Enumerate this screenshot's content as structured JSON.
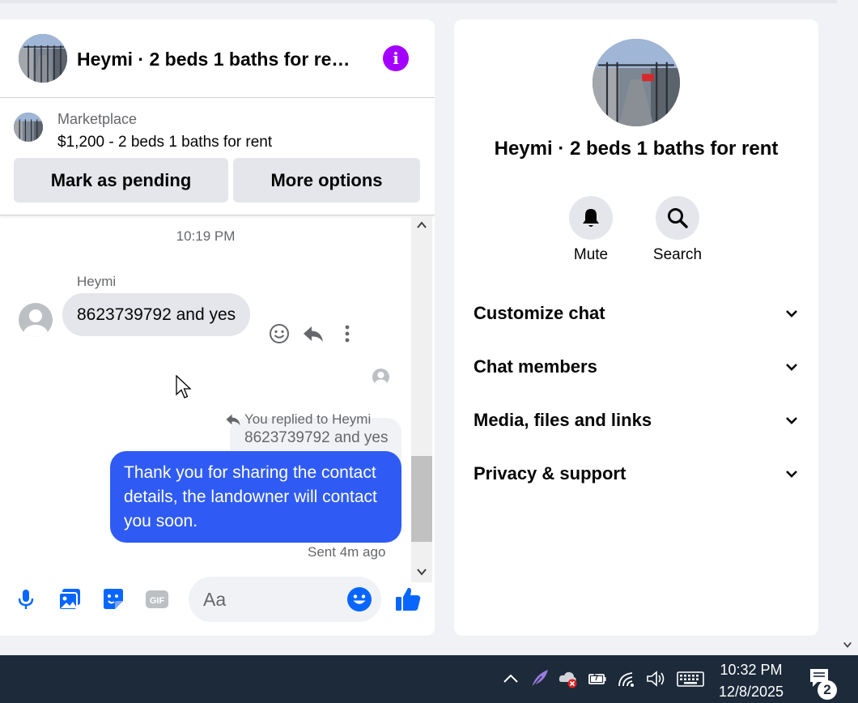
{
  "chat": {
    "title": "Heymi · 2 beds 1 baths for re…",
    "info_icon": "i",
    "listing": {
      "label": "Marketplace",
      "price_line": "$1,200 - 2 beds 1 baths for rent",
      "pending_button": "Mark as pending",
      "more_button": "More options"
    },
    "messages": {
      "timestamp": "10:19 PM",
      "sender_name": "Heymi",
      "incoming_text": "8623739792 and yes",
      "replied_label": "You replied to Heymi",
      "quoted_text": "8623739792 and yes",
      "outgoing_text": "Thank you for sharing the contact details, the landowner will contact you soon.",
      "sent_status": "Sent 4m ago"
    },
    "composer": {
      "placeholder": "Aa",
      "gif_label": "GIF"
    }
  },
  "info_panel": {
    "title": "Heymi · 2 beds 1 baths for rent",
    "actions": [
      {
        "label": "Mute",
        "icon": "bell-icon"
      },
      {
        "label": "Search",
        "icon": "search-icon"
      }
    ],
    "sections": [
      {
        "label": "Customize chat"
      },
      {
        "label": "Chat members"
      },
      {
        "label": "Media, files and links"
      },
      {
        "label": "Privacy & support"
      }
    ]
  },
  "taskbar": {
    "time": "10:32 PM",
    "date": "12/8/2025",
    "notification_count": "2"
  },
  "colors": {
    "accent_blue": "#2f5bf4",
    "info_purple": "#a400ff",
    "icon_blue": "#0866ff",
    "taskbar": "#1c2a3a"
  }
}
